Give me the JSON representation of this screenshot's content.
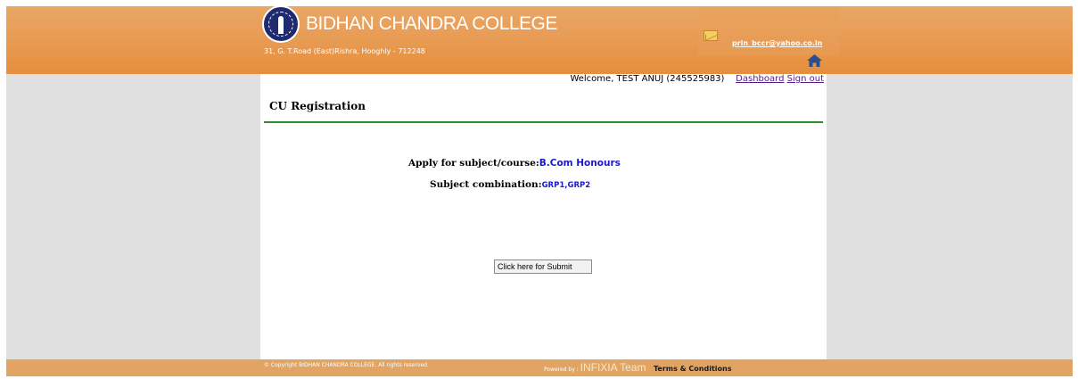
{
  "header": {
    "college_name": "BIDHAN CHANDRA COLLEGE",
    "address": "31, G. T.Road (East)Rishra, Hooghly - 712248",
    "email": "prin_bccr@yahoo.co.in"
  },
  "user_bar": {
    "welcome": "Welcome, TEST ANUJ (245525983)",
    "dashboard_label": "Dashboard",
    "signout_label": "Sign out"
  },
  "page": {
    "title": "CU Registration",
    "subject_label": "Apply for subject/course:",
    "subject_value": "B.Com Honours",
    "combination_label": "Subject combination:",
    "combination_value": "GRP1,GRP2",
    "submit_label": "Click here for Submit"
  },
  "footer": {
    "copyright": "© Copyright BIDHAN CHANDRA COLLEGE. All rights reserved.",
    "powered_by": "Powered by :",
    "team": "INFIXIA Team",
    "terms_label": "Terms & Conditions"
  },
  "colors": {
    "header_orange": "#e79a51",
    "side_gray": "#e0e0e0",
    "rule_green": "#2f8a2f",
    "value_blue": "#1a1acc",
    "link_purple": "#551a8b"
  },
  "icons": [
    "college-logo",
    "mail-icon",
    "home-icon"
  ]
}
